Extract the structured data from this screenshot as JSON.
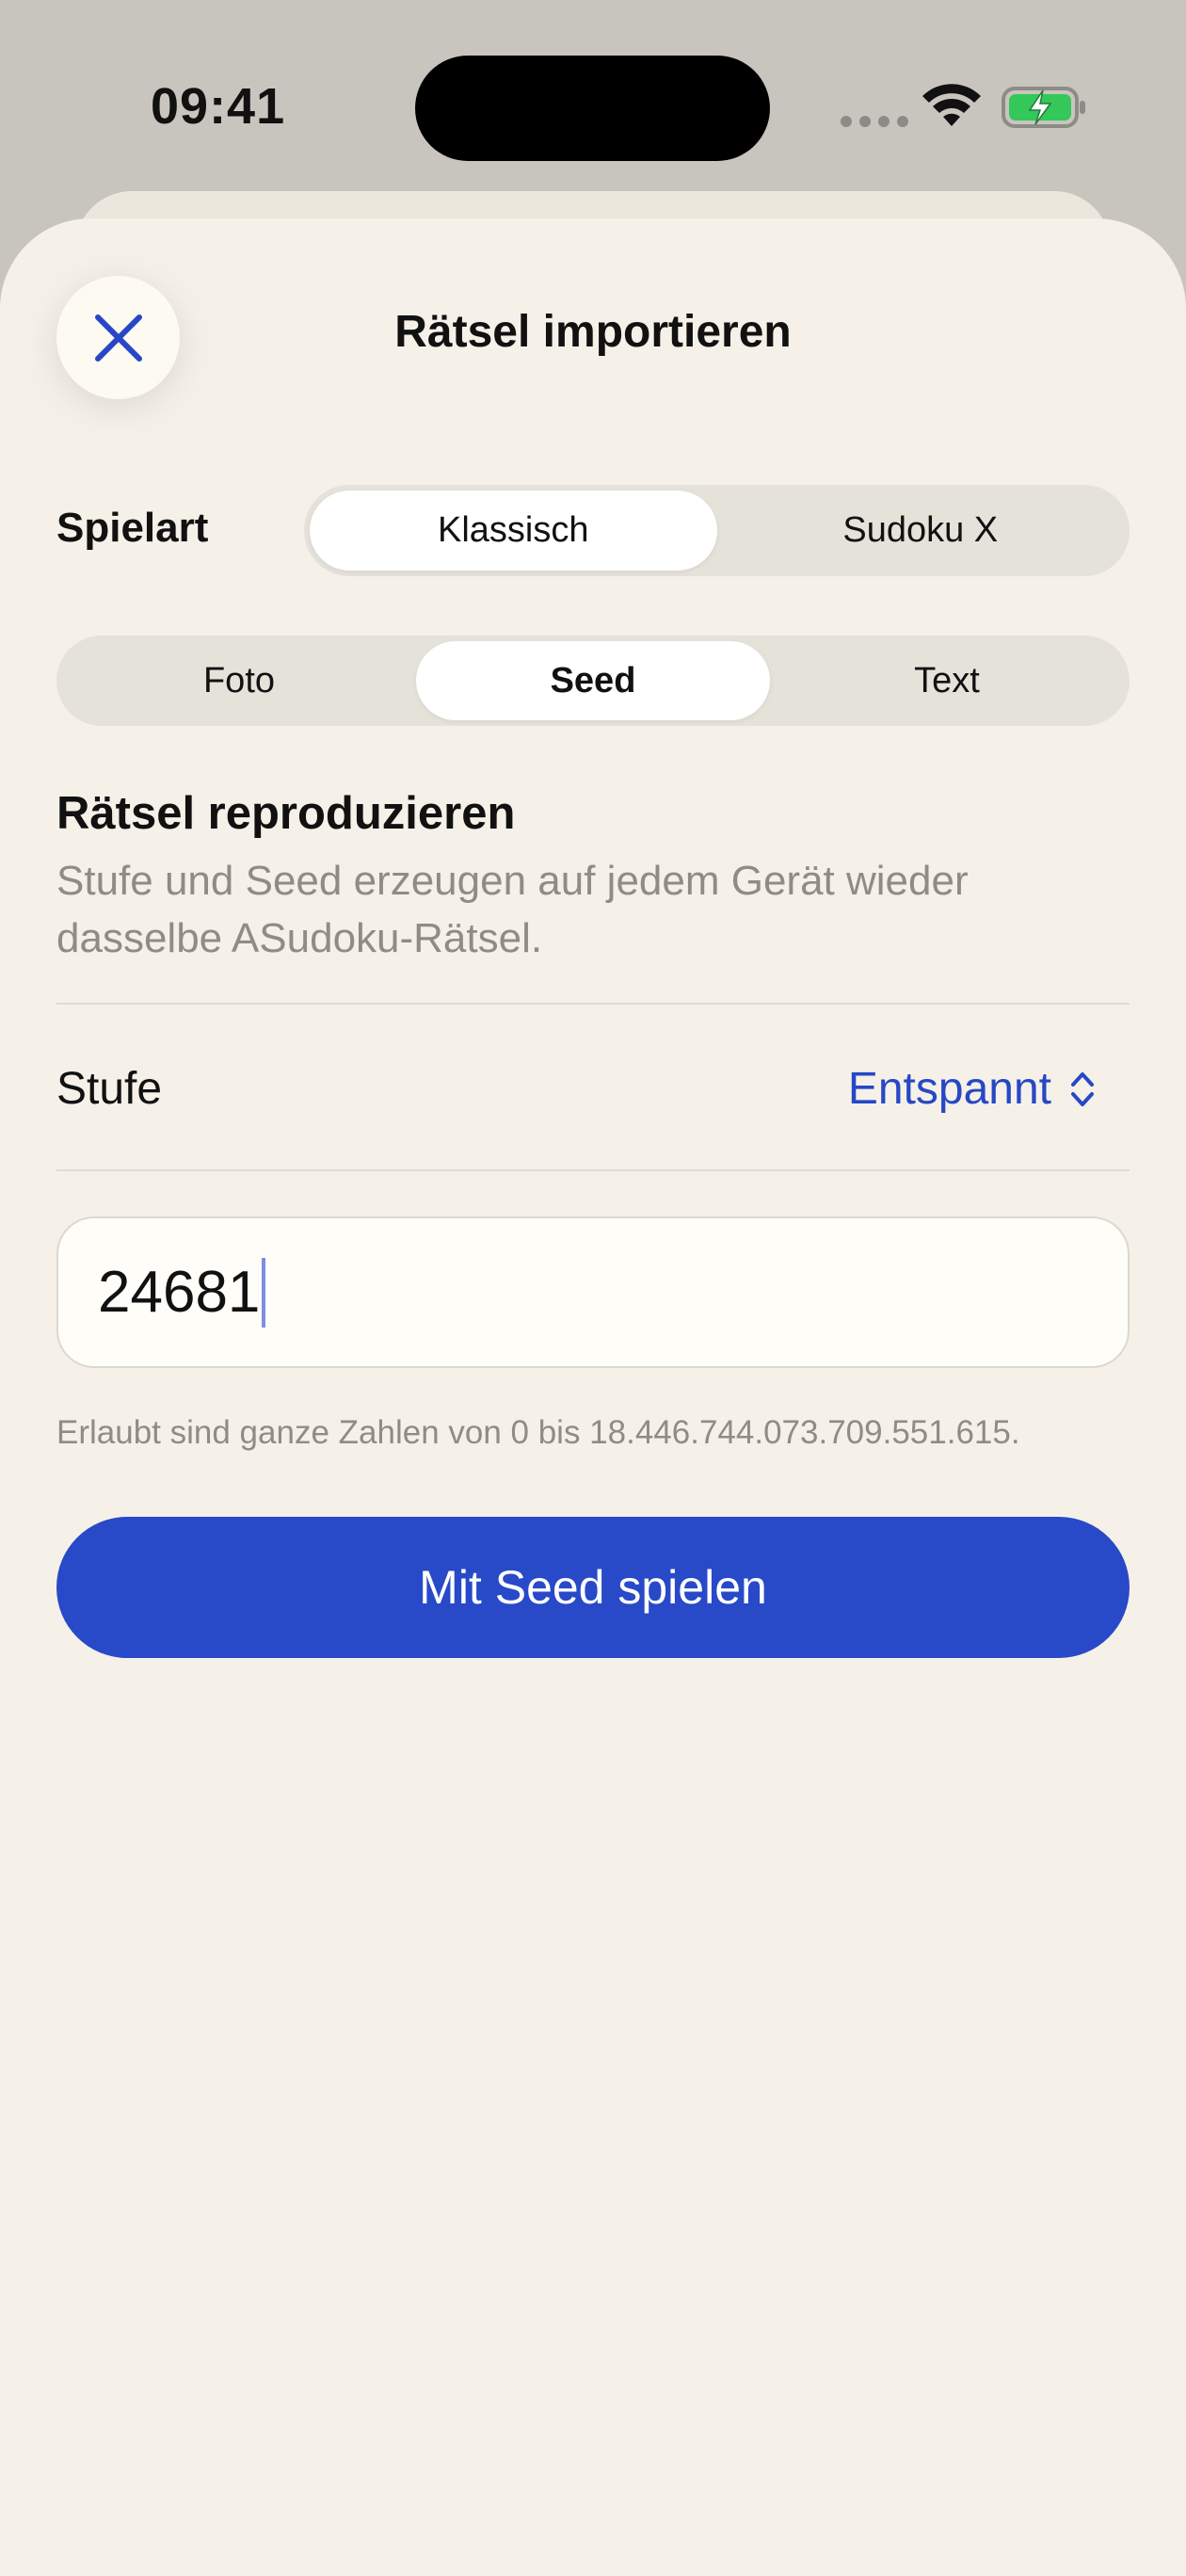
{
  "status_bar": {
    "time": "09:41"
  },
  "sheet": {
    "title": "Rätsel importieren"
  },
  "game_type": {
    "label": "Spielart",
    "options": [
      "Klassisch",
      "Sudoku X"
    ],
    "selected": "Klassisch"
  },
  "source_tabs": {
    "options": [
      "Foto",
      "Seed",
      "Text"
    ],
    "selected": "Seed"
  },
  "section": {
    "heading": "Rätsel reproduzieren",
    "description": "Stufe und Seed erzeugen auf jedem Gerät wieder dasselbe ASudoku-Rätsel."
  },
  "difficulty": {
    "label": "Stufe",
    "value": "Entspannt"
  },
  "seed_input": {
    "value": "24681"
  },
  "hint": "Erlaubt sind ganze Zahlen von 0 bis 18.446.744.073.709.551.615.",
  "play_button": {
    "label": "Mit Seed spielen"
  },
  "colors": {
    "accent": "#2849c8",
    "sheet_bg": "#f5f1e8",
    "battery": "#34c759"
  }
}
